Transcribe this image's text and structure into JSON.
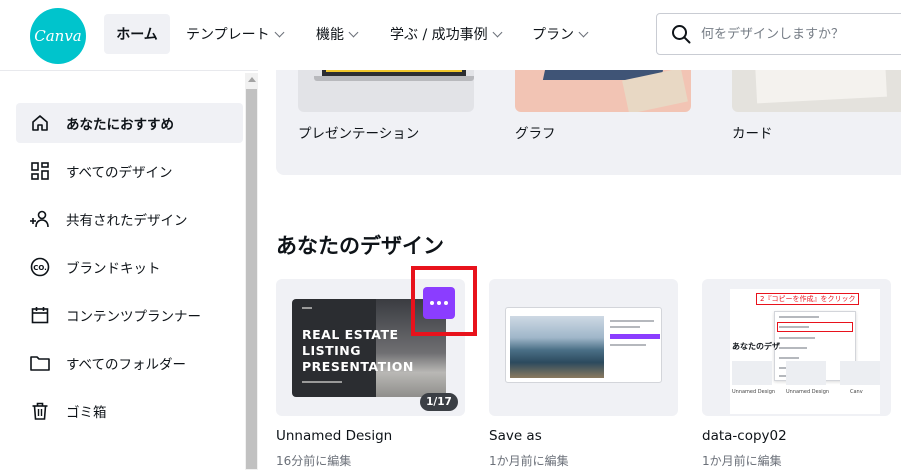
{
  "header": {
    "logo_text": "Canva",
    "nav": {
      "home": "ホーム",
      "templates": "テンプレート",
      "features": "機能",
      "learn": "学ぶ / 成功事例",
      "plans": "プラン"
    },
    "search": {
      "placeholder": "何をデザインしますか？"
    }
  },
  "sidebar": {
    "items": [
      {
        "label": "あなたにおすすめ",
        "icon": "home-icon",
        "active": true
      },
      {
        "label": "すべてのデザイン",
        "icon": "grid-icon"
      },
      {
        "label": "共有されたデザイン",
        "icon": "shared-users-icon"
      },
      {
        "label": "ブランドキット",
        "icon": "brand-kit-icon"
      },
      {
        "label": "コンテンツプランナー",
        "icon": "calendar-icon"
      },
      {
        "label": "すべてのフォルダー",
        "icon": "folder-icon"
      },
      {
        "label": "ゴミ箱",
        "icon": "trash-icon"
      }
    ],
    "brand_icon_text": "CO."
  },
  "templates": [
    {
      "label": "プレゼンテーション"
    },
    {
      "label": "グラフ"
    },
    {
      "label": "カード"
    }
  ],
  "designs_section": {
    "title": "あなたのデザイン"
  },
  "designs": [
    {
      "name": "Unnamed Design",
      "edited": "16分前に編集",
      "thumb_title": "REAL ESTATE LISTING PRESENTATION",
      "page_badge": "1/17"
    },
    {
      "name": "Save as",
      "edited": "1か月前に編集"
    },
    {
      "name": "data-copy02",
      "edited": "1か月前に編集",
      "thumb_callout": "2『コピーを作成』をクリック",
      "thumb_heading": "あなたのデザ",
      "thumb_labels": [
        "Unnamed Design",
        "Unnamed Design",
        "Canv"
      ]
    }
  ],
  "colors": {
    "brand_teal": "#00c4cc",
    "accent_purple": "#8b3dff",
    "highlight_red": "#e8121c",
    "panel_gray": "#f0f1f5"
  }
}
